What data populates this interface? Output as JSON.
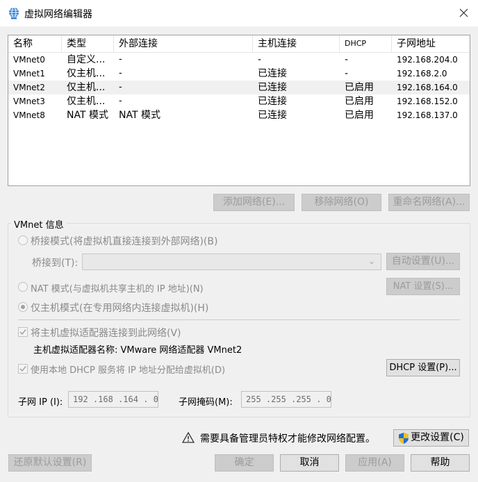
{
  "window": {
    "title": "虚拟网络编辑器"
  },
  "table": {
    "columns": [
      "名称",
      "类型",
      "外部连接",
      "主机连接",
      "DHCP",
      "子网地址"
    ],
    "rows": [
      {
        "name": "VMnet0",
        "type": "自定义...",
        "external": "-",
        "host": "-",
        "dhcp": "-",
        "subnet": "192.168.204.0"
      },
      {
        "name": "VMnet1",
        "type": "仅主机...",
        "external": "-",
        "host": "已连接",
        "dhcp": "-",
        "subnet": "192.168.2.0"
      },
      {
        "name": "VMnet2",
        "type": "仅主机...",
        "external": "-",
        "host": "已连接",
        "dhcp": "已启用",
        "subnet": "192.168.164.0"
      },
      {
        "name": "VMnet3",
        "type": "仅主机...",
        "external": "-",
        "host": "已连接",
        "dhcp": "已启用",
        "subnet": "192.168.152.0"
      },
      {
        "name": "VMnet8",
        "type": "NAT 模式",
        "external": "NAT 模式",
        "host": "已连接",
        "dhcp": "已启用",
        "subnet": "192.168.137.0"
      }
    ],
    "selected_row": "VMnet2"
  },
  "table_buttons": {
    "add": "添加网络(E)...",
    "remove": "移除网络(O)",
    "rename": "重命名网络(A)..."
  },
  "vmnet_info": {
    "group_title": "VMnet 信息",
    "bridged_label": "桥接模式(将虚拟机直接连接到外部网络)(B)",
    "bridged_to_label": "桥接到(T):",
    "auto_settings": "自动设置(U)...",
    "nat_label": "NAT 模式(与虚拟机共享主机的 IP 地址)(N)",
    "nat_settings": "NAT 设置(S)...",
    "hostonly_label": "仅主机模式(在专用网络内连接虚拟机)(H)",
    "connect_adapter_label": "将主机虚拟适配器连接到此网络(V)",
    "adapter_name_label": "主机虚拟适配器名称: VMware 网络适配器 VMnet2",
    "dhcp_label": "使用本地 DHCP 服务将 IP 地址分配给虚拟机(D)",
    "dhcp_settings": "DHCP 设置(P)...",
    "subnet_ip_label": "子网 IP (I):",
    "subnet_ip_value": "192 .168 .164 . 0",
    "subnet_mask_label": "子网掩码(M):",
    "subnet_mask_value": "255 .255 .255 . 0"
  },
  "admin_notice": "需要具备管理员特权才能修改网络配置。",
  "change_settings": "更改设置(C)",
  "footer": {
    "restore": "还原默认设置(R)",
    "ok": "确定",
    "cancel": "取消",
    "apply": "应用(A)",
    "help": "帮助"
  },
  "colors": {
    "window_bg": "#f0f0f0",
    "selected_row": "#f0f0f0",
    "disabled_text": "#8a8a8a",
    "primary_border": "#0078d7"
  }
}
